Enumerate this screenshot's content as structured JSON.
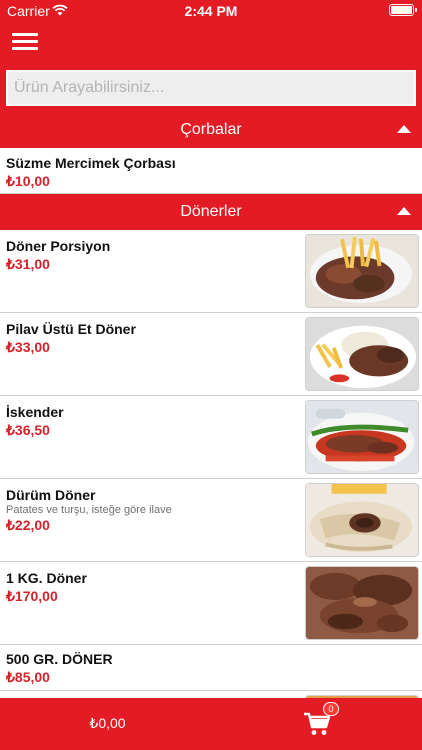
{
  "status_bar": {
    "carrier": "Carrier",
    "time": "2:44 PM"
  },
  "search": {
    "placeholder": "Ürün Arayabilirsiniz..."
  },
  "categories": [
    {
      "title": "Çorbalar",
      "items": [
        {
          "name": "Süzme Mercimek Çorbası",
          "price": "₺10,00"
        }
      ]
    },
    {
      "title": "Dönerler",
      "items": [
        {
          "name": "Döner Porsiyon",
          "price": "₺31,00"
        },
        {
          "name": "Pilav Üstü Et Döner",
          "price": "₺33,00"
        },
        {
          "name": "İskender",
          "price": "₺36,50"
        },
        {
          "name": "Dürüm Döner",
          "description": "Patates ve turşu, isteğe göre ilave",
          "price": "₺22,00"
        },
        {
          "name": "1 KG. Döner",
          "price": "₺170,00"
        },
        {
          "name": "500 GR. DÖNER",
          "price": "₺85,00"
        }
      ]
    }
  ],
  "bottom_bar": {
    "total": "₺0,00",
    "cart_count": "0"
  },
  "colors": {
    "accent": "#e21b24",
    "price": "#d0242c"
  }
}
